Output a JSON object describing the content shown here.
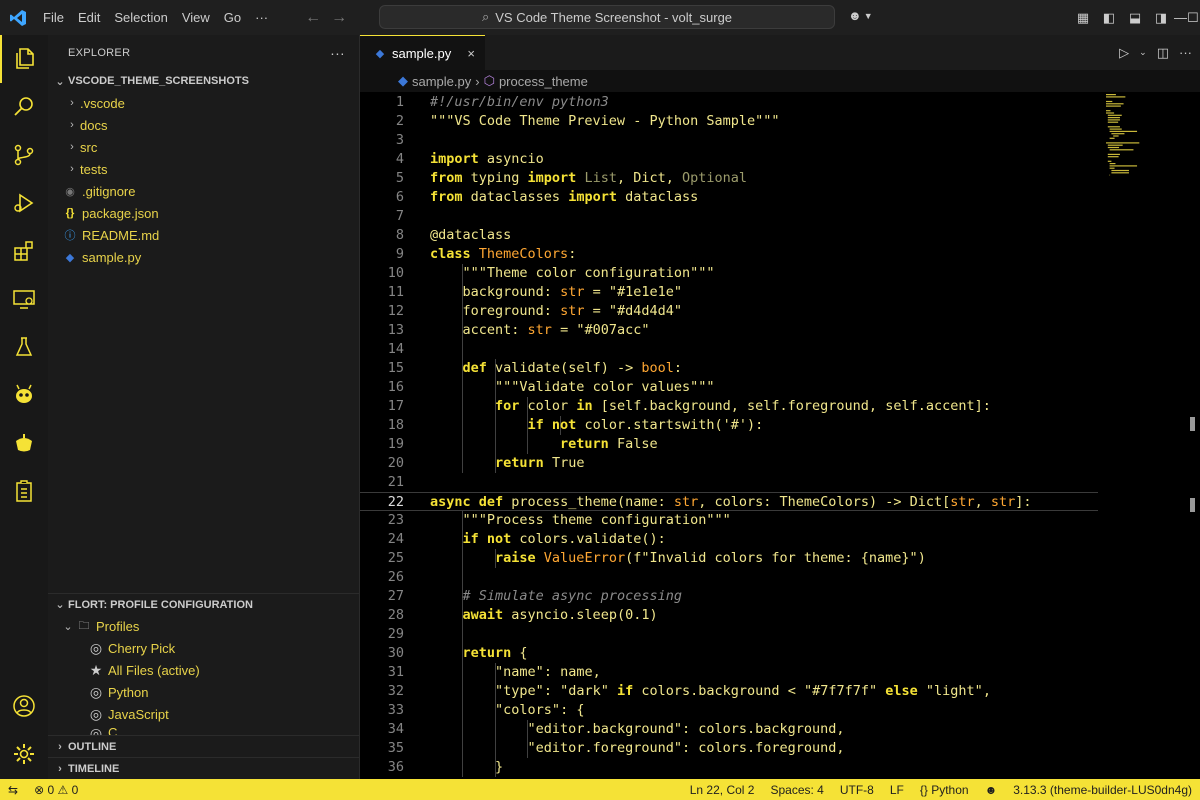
{
  "menu": [
    "File",
    "Edit",
    "Selection",
    "View",
    "Go",
    "···"
  ],
  "search_text": "VS Code Theme Screenshot - volt_surge",
  "explorer": {
    "title": "EXPLORER",
    "root": "VSCODE_THEME_SCREENSHOTS",
    "folders": [
      ".vscode",
      "docs",
      "src",
      "tests"
    ],
    "files": [
      {
        "name": ".gitignore",
        "icon": "◉"
      },
      {
        "name": "package.json",
        "icon": "{}"
      },
      {
        "name": "README.md",
        "icon": "ⓘ"
      },
      {
        "name": "sample.py",
        "icon": "◆"
      }
    ]
  },
  "profiles": {
    "title": "FLORT: PROFILE CONFIGURATION",
    "group": "Profiles",
    "items": [
      "Cherry Pick",
      "All Files (active)",
      "Python",
      "JavaScript",
      "C"
    ]
  },
  "outline": "OUTLINE",
  "timeline": "TIMELINE",
  "tab": {
    "label": "sample.py",
    "close": "×"
  },
  "breadcrumb": {
    "file": "sample.py",
    "sep": "›",
    "symbol": "process_theme"
  },
  "code_lines": [
    [
      [
        "c-cm",
        "#!/usr/bin/env python3"
      ]
    ],
    [
      [
        "c-str",
        "\"\"\"VS Code Theme Preview - Python Sample\"\"\""
      ]
    ],
    [],
    [
      [
        "c-kw",
        "import"
      ],
      [
        "c-txt",
        " asyncio"
      ]
    ],
    [
      [
        "c-kw",
        "from"
      ],
      [
        "c-txt",
        " typing "
      ],
      [
        "c-kw",
        "import"
      ],
      [
        "c-ty",
        " List"
      ],
      [
        "c-txt",
        ", "
      ],
      [
        "c-txt",
        "Dict"
      ],
      [
        "c-txt",
        ", "
      ],
      [
        "c-ty",
        "Optional"
      ]
    ],
    [
      [
        "c-kw",
        "from"
      ],
      [
        "c-txt",
        " dataclasses "
      ],
      [
        "c-kw",
        "import"
      ],
      [
        "c-txt",
        " dataclass"
      ]
    ],
    [],
    [
      [
        "c-txt",
        "@dataclass"
      ]
    ],
    [
      [
        "c-kw",
        "class"
      ],
      [
        "c-cls",
        " ThemeColors"
      ],
      [
        "c-txt",
        ":"
      ]
    ],
    [
      [
        "c-txt",
        "    "
      ],
      [
        "c-str",
        "\"\"\"Theme color configuration\"\"\""
      ]
    ],
    [
      [
        "c-txt",
        "    background"
      ],
      [
        "c-txt",
        ": "
      ],
      [
        "c-cls",
        "str"
      ],
      [
        "c-txt",
        " = "
      ],
      [
        "c-str",
        "\"#1e1e1e\""
      ]
    ],
    [
      [
        "c-txt",
        "    foreground"
      ],
      [
        "c-txt",
        ": "
      ],
      [
        "c-cls",
        "str"
      ],
      [
        "c-txt",
        " = "
      ],
      [
        "c-str",
        "\"#d4d4d4\""
      ]
    ],
    [
      [
        "c-txt",
        "    accent"
      ],
      [
        "c-txt",
        ": "
      ],
      [
        "c-cls",
        "str"
      ],
      [
        "c-txt",
        " = "
      ],
      [
        "c-str",
        "\"#007acc\""
      ]
    ],
    [],
    [
      [
        "c-txt",
        "    "
      ],
      [
        "c-kw",
        "def"
      ],
      [
        "c-id",
        " validate"
      ],
      [
        "c-txt",
        "(self) -> "
      ],
      [
        "c-cls",
        "bool"
      ],
      [
        "c-txt",
        ":"
      ]
    ],
    [
      [
        "c-txt",
        "        "
      ],
      [
        "c-str",
        "\"\"\"Validate color values\"\"\""
      ]
    ],
    [
      [
        "c-txt",
        "        "
      ],
      [
        "c-kw",
        "for"
      ],
      [
        "c-txt",
        " color "
      ],
      [
        "c-kw",
        "in"
      ],
      [
        "c-txt",
        " [self.background, self.foreground, self.accent]:"
      ]
    ],
    [
      [
        "c-txt",
        "            "
      ],
      [
        "c-kw",
        "if not"
      ],
      [
        "c-txt",
        " color.startswith("
      ],
      [
        "c-str",
        "'#'"
      ],
      [
        "c-txt",
        "):"
      ]
    ],
    [
      [
        "c-txt",
        "                "
      ],
      [
        "c-kw",
        "return"
      ],
      [
        "c-txt",
        " False"
      ]
    ],
    [
      [
        "c-txt",
        "        "
      ],
      [
        "c-kw",
        "return"
      ],
      [
        "c-txt",
        " True"
      ]
    ],
    [],
    [
      [
        "c-kw",
        "async"
      ],
      [
        "c-txt",
        " "
      ],
      [
        "c-kw",
        "def"
      ],
      [
        "c-id",
        " process_theme"
      ],
      [
        "c-txt",
        "(name: "
      ],
      [
        "c-cls",
        "str"
      ],
      [
        "c-txt",
        ", colors: ThemeColors) -> Dict["
      ],
      [
        "c-cls",
        "str"
      ],
      [
        "c-txt",
        ", "
      ],
      [
        "c-cls",
        "str"
      ],
      [
        "c-txt",
        "]:"
      ]
    ],
    [
      [
        "c-txt",
        "    "
      ],
      [
        "c-str",
        "\"\"\"Process theme configuration\"\"\""
      ]
    ],
    [
      [
        "c-txt",
        "    "
      ],
      [
        "c-kw",
        "if not"
      ],
      [
        "c-txt",
        " colors.validate():"
      ]
    ],
    [
      [
        "c-txt",
        "        "
      ],
      [
        "c-kw",
        "raise"
      ],
      [
        "c-cls",
        " ValueError"
      ],
      [
        "c-txt",
        "(f"
      ],
      [
        "c-str",
        "\"Invalid colors for theme: {name}\""
      ],
      [
        "c-txt",
        ")"
      ]
    ],
    [],
    [
      [
        "c-txt",
        "    "
      ],
      [
        "c-cm",
        "# Simulate async processing"
      ]
    ],
    [
      [
        "c-txt",
        "    "
      ],
      [
        "c-kw",
        "await"
      ],
      [
        "c-txt",
        " asyncio.sleep("
      ],
      [
        "c-num",
        "0.1"
      ],
      [
        "c-txt",
        ")"
      ]
    ],
    [],
    [
      [
        "c-txt",
        "    "
      ],
      [
        "c-kw",
        "return"
      ],
      [
        "c-txt",
        " {"
      ]
    ],
    [
      [
        "c-txt",
        "        "
      ],
      [
        "c-str",
        "\"name\""
      ],
      [
        "c-txt",
        ": name,"
      ]
    ],
    [
      [
        "c-txt",
        "        "
      ],
      [
        "c-str",
        "\"type\""
      ],
      [
        "c-txt",
        ": "
      ],
      [
        "c-str",
        "\"dark\""
      ],
      [
        "c-txt",
        " "
      ],
      [
        "c-kw",
        "if"
      ],
      [
        "c-txt",
        " colors.background < "
      ],
      [
        "c-str",
        "\"#7f7f7f\""
      ],
      [
        "c-txt",
        " "
      ],
      [
        "c-kw",
        "else"
      ],
      [
        "c-txt",
        " "
      ],
      [
        "c-str",
        "\"light\""
      ],
      [
        "c-txt",
        ","
      ]
    ],
    [
      [
        "c-txt",
        "        "
      ],
      [
        "c-str",
        "\"colors\""
      ],
      [
        "c-txt",
        ": {"
      ]
    ],
    [
      [
        "c-txt",
        "            "
      ],
      [
        "c-str",
        "\"editor.background\""
      ],
      [
        "c-txt",
        ": colors.background,"
      ]
    ],
    [
      [
        "c-txt",
        "            "
      ],
      [
        "c-str",
        "\"editor.foreground\""
      ],
      [
        "c-txt",
        ": colors.foreground,"
      ]
    ],
    [
      [
        "c-txt",
        "        }"
      ]
    ]
  ],
  "current_line": 22,
  "status": {
    "errors": "0",
    "warnings": "0",
    "position": "Ln 22, Col 2",
    "spaces": "Spaces: 4",
    "encoding": "UTF-8",
    "eol": "LF",
    "language": "Python",
    "interpreter": "3.13.3 (theme-builder-LUS0dn4g)"
  },
  "colors": {
    "accent": "#f5e236",
    "keyword": "#f5e236",
    "class": "#ffa733",
    "string": "#f0e68c"
  }
}
